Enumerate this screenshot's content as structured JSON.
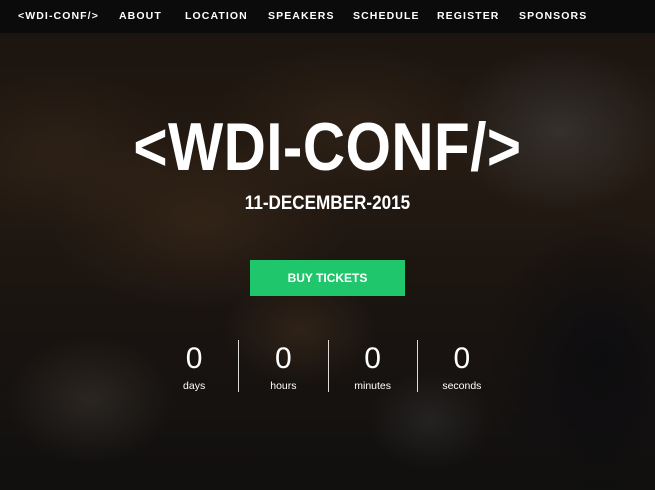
{
  "nav": {
    "brand": "<WDI-CONF/>",
    "links": [
      "ABOUT",
      "LOCATION",
      "SPEAKERS",
      "SCHEDULE",
      "REGISTER",
      "SPONSORS"
    ]
  },
  "hero": {
    "title": "<WDI-CONF/>",
    "date": "11-DECEMBER-2015",
    "cta_label": "BUY TICKETS",
    "cta_color": "#1fc66c"
  },
  "countdown": [
    {
      "value": "0",
      "label": "days"
    },
    {
      "value": "0",
      "label": "hours"
    },
    {
      "value": "0",
      "label": "minutes"
    },
    {
      "value": "0",
      "label": "seconds"
    }
  ]
}
